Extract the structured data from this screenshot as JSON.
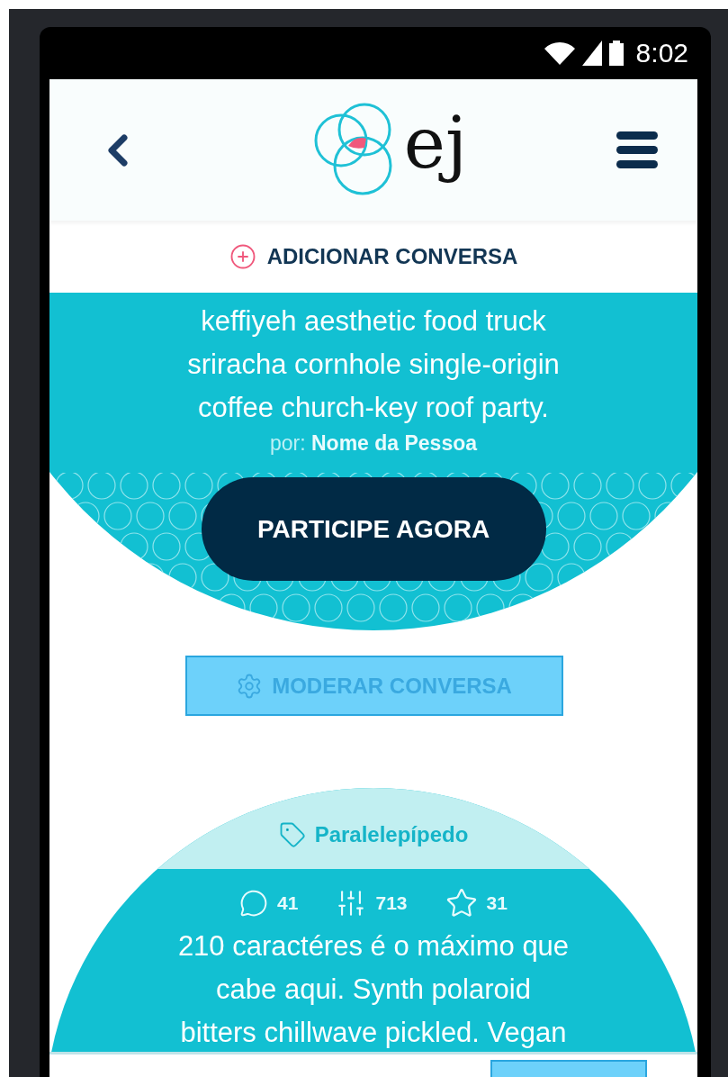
{
  "status_bar": {
    "time": "8:02"
  },
  "header": {
    "logo_text": "ej"
  },
  "add_button": {
    "label": "ADICIONAR CONVERSA"
  },
  "featured": {
    "text_lines": [
      "keffiyeh aesthetic food truck",
      "sriracha cornhole single-origin",
      "coffee church-key roof party."
    ],
    "author": "por: **Nome da Pessoa**",
    "button": "PARTICIPE AGORA"
  },
  "moderate_button": {
    "label": "MODERAR CONVERSA"
  },
  "conversation": {
    "tag": "Paralelepípedo",
    "stats": [
      {
        "kind": "comments",
        "value": "41"
      },
      {
        "kind": "votes",
        "value": "713"
      },
      {
        "kind": "favorites",
        "value": "31"
      }
    ],
    "text_lines": [
      "210 caractéres é o máximo que",
      "cabe aqui. Synth polaroid",
      "bitters chillwave pickled. Vegan"
    ]
  }
}
